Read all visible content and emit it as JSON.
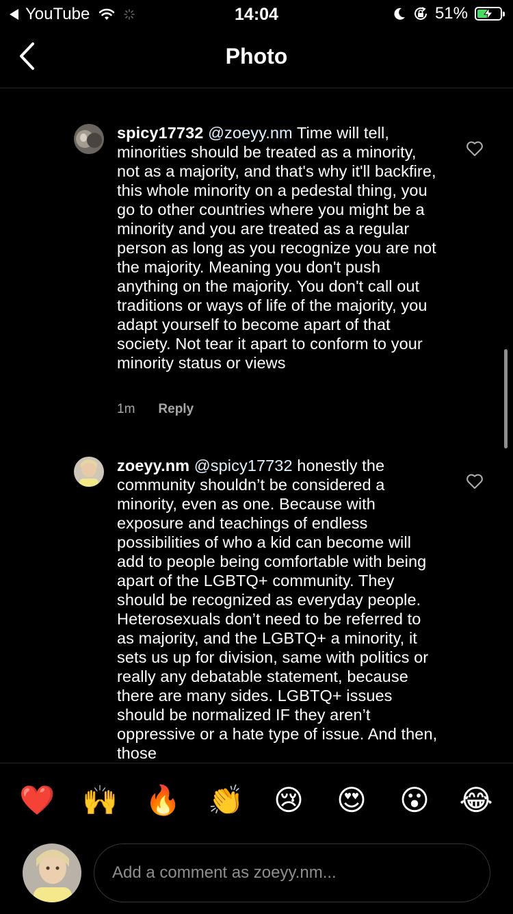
{
  "status_bar": {
    "back_app": "YouTube",
    "time": "14:04",
    "battery_percent": "51%",
    "battery_level": 0.51,
    "icons": [
      "wifi-icon",
      "loading-icon",
      "moon-icon",
      "rotation-lock-icon",
      "battery-charging-icon"
    ]
  },
  "nav": {
    "title": "Photo",
    "back_icon": "chevron-left-icon"
  },
  "comments": [
    {
      "username": "spicy17732",
      "mention": "@zoeyy.nm",
      "text": " Time will tell, minorities should be treated as a minority, not as a majority, and that's why it'll backfire, this whole minority on a pedestal thing, you go to other countries where you might be a minority and you are treated as a regular person as long as you recognize you are not the majority. Meaning you don't push anything on the majority. You don't call out traditions or ways of life of the majority, you adapt yourself to become apart of that society. Not tear it apart to conform to your minority status or views",
      "time": "1m",
      "reply_label": "Reply"
    },
    {
      "username": "zoeyy.nm",
      "mention": "@spicy17732",
      "text": " honestly the community shouldn’t be considered a minority, even as one. Because with exposure and teachings of endless possibilities of who a kid can become will add to people being comfortable with being apart of the LGBTQ+ community. They should be recognized as everyday people. Heterosexuals don’t need to be referred to as majority, and the LGBTQ+ a minority, it sets us up for division, same with politics or really any debatable statement, because there are many sides. LGBTQ+ issues should be normalized IF they aren’t oppressive or a hate type of issue. And then, those"
    }
  ],
  "reactions": [
    "❤️",
    "🙌",
    "🔥",
    "👏",
    "😢",
    "😍",
    "😮",
    "😂"
  ],
  "composer": {
    "placeholder": "Add a comment as zoeyy.nm..."
  },
  "colors": {
    "background": "#000000",
    "secondary_text": "#a8a8a8",
    "divider": "#262626",
    "battery_fill": "#4cd964"
  }
}
